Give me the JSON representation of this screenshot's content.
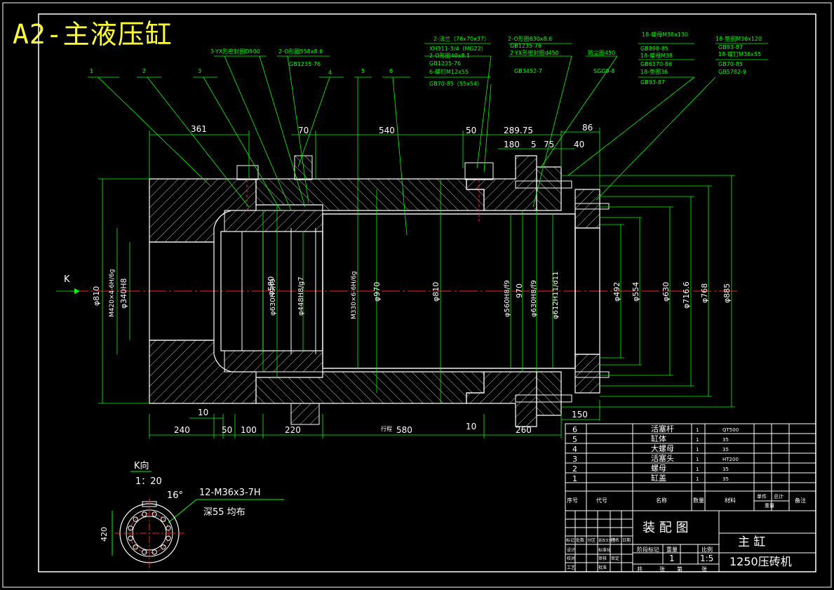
{
  "title": "A2-主液压缸",
  "colors": {
    "background": "#000000",
    "part": "#ffffff",
    "dimension": "#00ff00",
    "centerline": "#ff2020",
    "hatch": "#cfcfcf",
    "title": "#ffff33"
  },
  "view_label": "K",
  "leaders": {
    "numbers": [
      "1",
      "2",
      "3",
      "4",
      "5",
      "6"
    ],
    "notes": [
      "3-YX形密封圈D500",
      "2-O形圈558x8.6",
      "GB1235-76",
      "2-法兰（76x70x37）",
      "XH311-3/4（MG22）",
      "2-O形圈40x8.1",
      "GB1235-76",
      "6-螺钉M12x55",
      "GB70-85（55x54）",
      "2-O形圈630x8.6",
      "GB1235-76",
      "2-YX形密封圈d450",
      "GB3452-7",
      "防尘圈450",
      "SGG9-8",
      "18-螺母M38x130",
      "GB898-85",
      "18-螺母M38",
      "GB6170-86",
      "18-垫圈36",
      "GB93-87",
      "18-垫圈M36x120",
      "GB93-87",
      "18-螺钉M36x55",
      "GB70-85",
      "GB5782-9"
    ]
  },
  "dimensions": {
    "top": [
      "361",
      "70",
      "540",
      "50",
      "289.75",
      "180",
      "5",
      "75",
      "86",
      "40"
    ],
    "bottom": [
      "10",
      "240",
      "50",
      "100",
      "220",
      "行程",
      "580",
      "10",
      "260",
      "150"
    ],
    "left_diam": [
      "φ810",
      "M420×4-6H/6g",
      "φ340H8"
    ],
    "middle_diam": [
      "φ580",
      "φ630H9/f9",
      "φ448H8/g7",
      "M330×6-6H/6g",
      "φ970",
      "φ810"
    ],
    "right_diam": [
      "φ560H8/f9",
      "970",
      "φ630H8/f9",
      "φ612H11/d11",
      "φ492",
      "φ554",
      "φ630",
      "φ716.6",
      "φ768",
      "φ885"
    ]
  },
  "k_view": {
    "title": "K向",
    "scale": "1：20",
    "angle": "16°",
    "note1": "12-M36x3-7H",
    "note2": "深55  均布",
    "dim": "420"
  },
  "bom": {
    "rows": [
      {
        "no": "6",
        "name": "活塞杆",
        "qty": "1",
        "material": "QT500"
      },
      {
        "no": "5",
        "name": "缸体",
        "qty": "1",
        "material": "35"
      },
      {
        "no": "4",
        "name": "大螺母",
        "qty": "1",
        "material": "35"
      },
      {
        "no": "3",
        "name": "活塞头",
        "qty": "1",
        "material": "HT200"
      },
      {
        "no": "2",
        "name": "螺母",
        "qty": "1",
        "material": "35"
      },
      {
        "no": "1",
        "name": "缸盖",
        "qty": "1",
        "material": "35"
      }
    ],
    "header": {
      "no": "序号",
      "code": "代号",
      "name": "名称",
      "qty": "数量",
      "material": "材料",
      "unit_weight": "单件",
      "total_weight": "总计",
      "weight": "重量",
      "remark": "备注"
    }
  },
  "title_block": {
    "drawing_type": "装 配 图",
    "part": "主 缸",
    "machine": "1250压砖机",
    "labels": [
      "标记",
      "处数",
      "分区",
      "更改文件号",
      "签名",
      "日期",
      "设计",
      "标准化",
      "校对",
      "审核",
      "审定",
      "工艺",
      "批准"
    ],
    "stage_label": "阶段标记",
    "weight_label": "重量",
    "scale_label": "比例",
    "qty": "1",
    "scale": "1:5",
    "sheet_labels": [
      "共",
      "张",
      "第",
      "张"
    ]
  }
}
